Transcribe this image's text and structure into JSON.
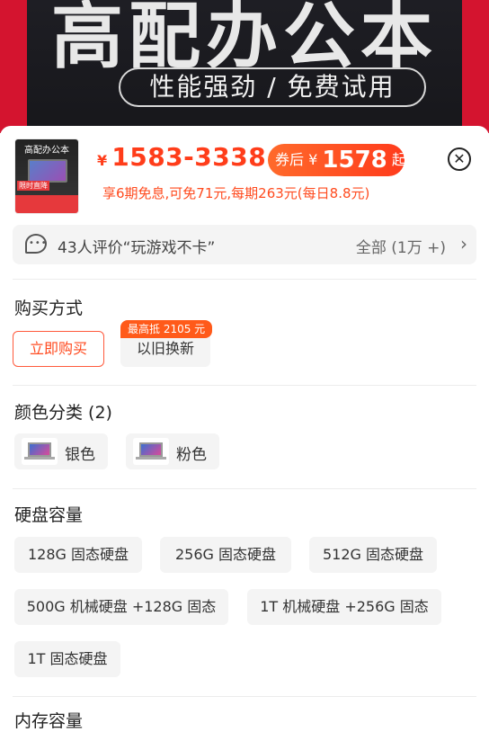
{
  "banner": {
    "title": "高配办公本",
    "subtitle": "性能强劲 / 免费试用"
  },
  "product": {
    "thumb_title": "高配办公本",
    "thumb_badge": "限时直降",
    "price_symbol": "¥",
    "price_range": "1583-3338",
    "coupon_prefix": "券后",
    "coupon_symbol": "¥",
    "coupon_price": "1578",
    "coupon_suffix": "起",
    "installment": "享6期免息,可免71元,每期263元(每日8.8元)"
  },
  "review": {
    "text": "43人评价“玩游戏不卡”",
    "all": "全部 (1万 +)"
  },
  "purchase": {
    "title": "购买方式",
    "options": [
      "立即购买",
      "以旧换新"
    ],
    "trade_in_tag": "最高抵 2105 元"
  },
  "color": {
    "title": "颜色分类 (2)",
    "options": [
      "银色",
      "粉色"
    ]
  },
  "storage": {
    "title": "硬盘容量",
    "options": [
      "128G 固态硬盘",
      "256G 固态硬盘",
      "512G 固态硬盘",
      "500G 机械硬盘 +128G 固态",
      "1T 机械硬盘 +256G 固态",
      "1T 固态硬盘"
    ]
  },
  "memory": {
    "title": "内存容量"
  },
  "colors": {
    "accent": "#ff3d1a",
    "coupon_bg": "#ff4a22",
    "chip_bg": "#f4f4f4"
  }
}
